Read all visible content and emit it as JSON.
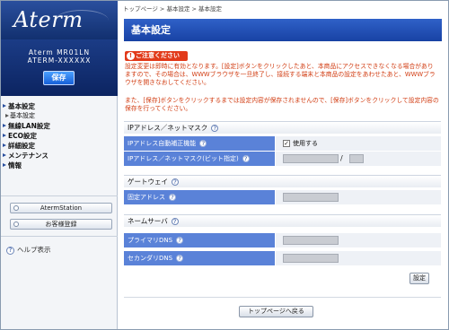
{
  "sidebar": {
    "logo": "Aterm",
    "model_name": "Aterm MR01LN",
    "model_id": "ATERM-XXXXXX",
    "save_label": "保存",
    "nav": [
      {
        "label": "基本設定",
        "sub": false
      },
      {
        "label": "基本設定",
        "sub": true
      },
      {
        "label": "無線LAN設定",
        "sub": false
      },
      {
        "label": "ECO設定",
        "sub": false
      },
      {
        "label": "詳細設定",
        "sub": false
      },
      {
        "label": "メンテナンス",
        "sub": false
      },
      {
        "label": "情報",
        "sub": false
      }
    ],
    "station_button": "AtermStation",
    "register_button": "お客様登録",
    "help_label": "ヘルプ表示"
  },
  "main": {
    "breadcrumb": "トップページ > 基本設定 > 基本設定",
    "title": "基本設定",
    "caution_label": "ご注意ください",
    "notice1": "設定変更は即時に有効となります。[設定]ボタンをクリックしたあと、本商品にアクセスできなくなる場合がありますので、その場合は、WWWブラウザを一旦終了し、接続する端末と本商品の設定をあわせたあと、WWWブラウザを開きなおしてください。",
    "notice2": "また、[保存]ボタンをクリックするまでは設定内容が保存されませんので、[保存]ボタンをクリックして設定内容の保存を行ってください。",
    "sections": {
      "ip": {
        "heading": "IPアドレス／ネットマスク",
        "auto_label": "IPアドレス自動補正機能",
        "auto_checkbox_label": "使用する",
        "auto_checked": true,
        "ip_label": "IPアドレス／ネットマスク(ビット指定)",
        "ip_value": "",
        "mask_value": "",
        "separator": "/"
      },
      "gateway": {
        "heading": "ゲートウェイ",
        "fixed_label": "固定アドレス",
        "fixed_value": ""
      },
      "dns": {
        "heading": "ネームサーバ",
        "primary_label": "プライマリDNS",
        "primary_value": "",
        "secondary_label": "セカンダリDNS",
        "secondary_value": ""
      }
    },
    "help_glyph": "?",
    "apply_label": "設定",
    "back_label": "トップページへ戻る"
  }
}
